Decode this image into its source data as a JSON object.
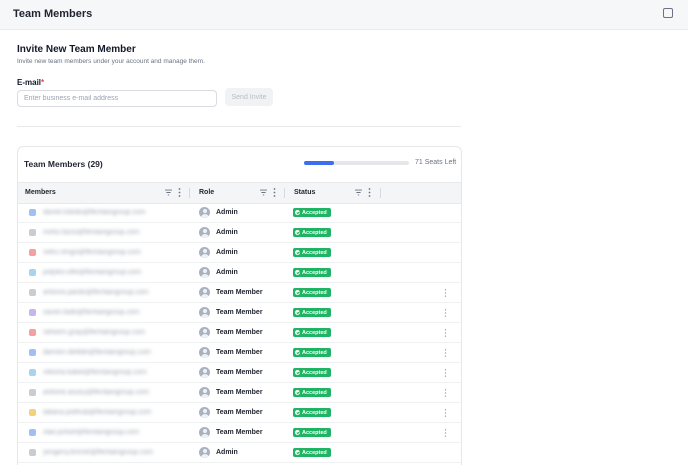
{
  "header": {
    "title": "Team Members"
  },
  "invite": {
    "title": "Invite New Team Member",
    "description": "Invite new team members under your account and manage them.",
    "email_label": "E-mail",
    "required_mark": "*",
    "email_placeholder": "Enter business e-mail address",
    "send_label": "Send Invite"
  },
  "team": {
    "title": "Team Members (29)",
    "seats_used_fraction": 0.29,
    "seats_label": "71 Seats Left",
    "columns": {
      "members": "Members",
      "role": "Role",
      "status": "Status"
    },
    "rows": [
      {
        "email": "daniel.toledo@flentaingroup.com",
        "role": "Admin",
        "status": "Accepted",
        "icon_color": "#9fc0f5",
        "menu": false
      },
      {
        "email": "mirko.fazio@flentaingroup.com",
        "role": "Admin",
        "status": "Accepted",
        "icon_color": "#c9ccd2",
        "menu": false
      },
      {
        "email": "neko.rengo@flentaingroup.com",
        "role": "Admin",
        "status": "Accepted",
        "icon_color": "#f2a0a0",
        "menu": false
      },
      {
        "email": "jodyleo.elfe@flentaingroup.com",
        "role": "Admin",
        "status": "Accepted",
        "icon_color": "#a6d4f2",
        "menu": false
      },
      {
        "email": "antonio.pardo@flentaingroup.com",
        "role": "Team Member",
        "status": "Accepted",
        "icon_color": "#c9ccd2",
        "menu": true
      },
      {
        "email": "xavier.fade@flentaingroup.com",
        "role": "Team Member",
        "status": "Accepted",
        "icon_color": "#c6b6f0",
        "menu": true
      },
      {
        "email": "raheem.gray@flentaingroup.com",
        "role": "Team Member",
        "status": "Accepted",
        "icon_color": "#f2a0a0",
        "menu": true
      },
      {
        "email": "damien.delilde@flentaingroup.com",
        "role": "Team Member",
        "status": "Accepted",
        "icon_color": "#9fc0f5",
        "menu": true
      },
      {
        "email": "viktoria.kabel@flentaingroup.com",
        "role": "Team Member",
        "status": "Accepted",
        "icon_color": "#a6d4f2",
        "menu": true
      },
      {
        "email": "antoine.assey@flentaingroup.com",
        "role": "Team Member",
        "status": "Accepted",
        "icon_color": "#c9ccd2",
        "menu": true
      },
      {
        "email": "tatiana.polihub@flentaingroup.com",
        "role": "Team Member",
        "status": "Accepted",
        "icon_color": "#f3d37a",
        "menu": true
      },
      {
        "email": "vlae.potsel@flentaingroup.com",
        "role": "Team Member",
        "status": "Accepted",
        "icon_color": "#9fc0f5",
        "menu": true
      },
      {
        "email": "yevgeny.brenet@flentaingroup.com",
        "role": "Admin",
        "status": "Accepted",
        "icon_color": "#c9ccd2",
        "menu": false
      }
    ]
  }
}
